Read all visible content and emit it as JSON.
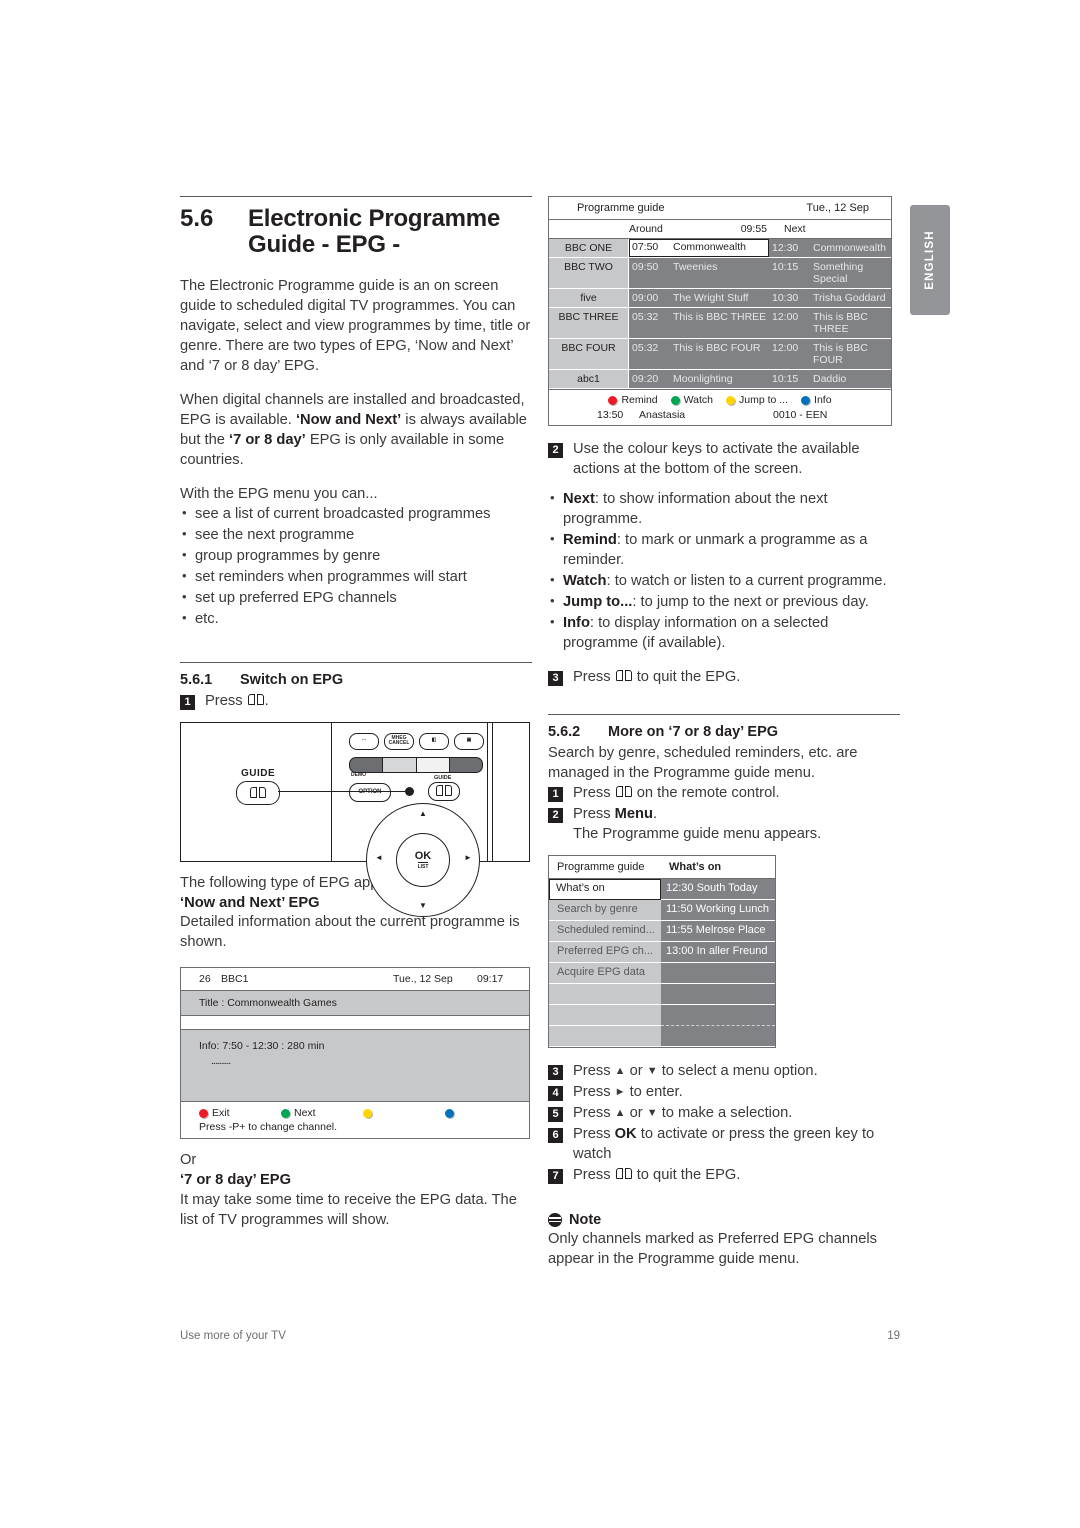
{
  "lang_tab": "ENGLISH",
  "footer": {
    "left": "Use more of your TV",
    "page": "19"
  },
  "section": {
    "number": "5.6",
    "title": "Electronic Programme Guide - EPG -",
    "intro_p1": "The Electronic Programme guide is an on screen guide to scheduled digital TV programmes. You can navigate, select and view programmes by time, title or genre. There are two types of EPG, ‘Now and Next’ and ‘7 or 8 day’ EPG.",
    "intro_p2_a": "When digital channels are installed and broadcasted, EPG is available. ",
    "intro_p2_b": "‘Now and Next’",
    "intro_p2_c": " is always available but the ",
    "intro_p2_d": "‘7 or 8 day’",
    "intro_p2_e": " EPG is only available in some countries.",
    "menu_intro": "With the EPG menu you can...",
    "menu_bullets": [
      "see a list of current broadcasted programmes",
      "see the next programme",
      "group programmes by genre",
      "set reminders when programmes will start",
      "set up preferred EPG channels",
      "etc."
    ]
  },
  "sub561": {
    "number": "5.6.1",
    "title": "Switch on EPG",
    "step1_n": "1",
    "step1_text_a": "Press ",
    "step1_text_b": ".",
    "after_remote": "The following type of EPG appears:",
    "now_next_heading": "‘Now and Next’ EPG",
    "now_next_body": "Detailed information about the current programme is shown.",
    "or": "Or",
    "seven_day_heading": "‘7 or 8 day’ EPG",
    "seven_day_body": "It may take some time to receive the EPG data. The list of TV programmes will show."
  },
  "sub562": {
    "number": "5.6.2",
    "title": "More on ‘7 or 8 day’ EPG",
    "intro": "Search by genre, scheduled reminders, etc. are managed in the Programme guide menu.",
    "step1_n": "1",
    "step1_a": "Press ",
    "step1_b": " on the remote control.",
    "step2_n": "2",
    "step2_a": "Press ",
    "step2_bold": "Menu",
    "step2_b": ".",
    "step2_cont": "The Programme guide menu appears.",
    "step3_n": "3",
    "step3_a": "Press ",
    "step3_b": " or ",
    "step3_c": " to select a menu option.",
    "step4_n": "4",
    "step4_a": "Press ",
    "step4_b": " to enter.",
    "step5_n": "5",
    "step5_a": "Press ",
    "step5_b": " or ",
    "step5_c": " to make a selection.",
    "step6_n": "6",
    "step6_a": "Press ",
    "step6_bold": "OK",
    "step6_b": " to activate or press the green key to",
    "step6_cont": "watch",
    "step7_n": "7",
    "step7_a": "Press ",
    "step7_b": " to quit the EPG."
  },
  "colour_keys": {
    "step_n": "2",
    "intro_a": "Use the colour keys to activate the available",
    "intro_b": "actions at the bottom of the screen.",
    "items": [
      {
        "label": "Next",
        "desc": ": to show information about the next programme."
      },
      {
        "label": "Remind",
        "desc": ": to mark or unmark a programme as a reminder."
      },
      {
        "label": "Watch",
        "desc": ": to watch or listen to a current programme."
      },
      {
        "label": "Jump to...",
        "desc": ": to jump to the next or previous day."
      },
      {
        "label": "Info",
        "desc": ": to display information on a selected programme (if available)."
      }
    ],
    "quit_n": "3",
    "quit_a": "Press ",
    "quit_b": " to quit the EPG."
  },
  "note": {
    "heading": "Note",
    "body": "Only channels marked as Preferred EPG channels appear in the Programme guide menu."
  },
  "epg_screen": {
    "title": "Programme guide",
    "date": "Tue., 12 Sep",
    "col_around": "Around",
    "col_time": "09:55",
    "col_next": "Next",
    "rows": [
      {
        "channel": "BBC ONE",
        "now_time": "07:50",
        "now_title": "Commonwealth",
        "next_time": "12:30",
        "next_title": "Commonwealth",
        "selected": true
      },
      {
        "channel": "BBC TWO",
        "now_time": "09:50",
        "now_title": "Tweenies",
        "next_time": "10:15",
        "next_title": "Something Special",
        "selected": false
      },
      {
        "channel": "five",
        "now_time": "09:00",
        "now_title": "The Wright Stuff",
        "next_time": "10:30",
        "next_title": "Trisha Goddard",
        "selected": false
      },
      {
        "channel": "BBC THREE",
        "now_time": "05:32",
        "now_title": "This is BBC THREE",
        "next_time": "12:00",
        "next_title": "This is BBC THREE",
        "selected": false
      },
      {
        "channel": "BBC FOUR",
        "now_time": "05:32",
        "now_title": "This is BBC FOUR",
        "next_time": "12:00",
        "next_title": "This is BBC FOUR",
        "selected": false
      },
      {
        "channel": "abc1",
        "now_time": "09:20",
        "now_title": "Moonlighting",
        "next_time": "10:15",
        "next_title": "Daddio",
        "selected": false
      }
    ],
    "keys": [
      {
        "colour": "#ed1c24",
        "label": "Remind"
      },
      {
        "colour": "#00a651",
        "label": "Watch"
      },
      {
        "colour": "#ffd400",
        "label": "Jump to ..."
      },
      {
        "colour": "#0072bc",
        "label": "Info"
      }
    ],
    "bottom_time": "13:50",
    "bottom_name": "Anastasia",
    "bottom_channel": "0010 - EEN"
  },
  "nownext_screen": {
    "channel_number": "26",
    "channel_name": "BBC1",
    "date": "Tue., 12 Sep",
    "time": "09:17",
    "title_line": "Title : Commonwealth Games",
    "info_line": "Info: 7:50 - 12:30 : 280 min",
    "info_dashes": "..........",
    "keys": [
      {
        "colour": "#ed1c24",
        "label": "Exit"
      },
      {
        "colour": "#00a651",
        "label": "Next"
      },
      {
        "colour": "#ffd400",
        "label": ""
      },
      {
        "colour": "#0072bc",
        "label": ""
      }
    ],
    "hint": "Press -P+ to change channel."
  },
  "pgmenu_screen": {
    "header_left": "Programme guide",
    "header_right": "What’s on",
    "left_items": [
      {
        "label": "What’s on",
        "selected": true
      },
      {
        "label": "Search by genre",
        "selected": false
      },
      {
        "label": "Scheduled remind...",
        "selected": false
      },
      {
        "label": "Preferred EPG ch...",
        "selected": false
      },
      {
        "label": "Acquire EPG data",
        "selected": false
      },
      {
        "label": "",
        "selected": false
      },
      {
        "label": "",
        "selected": false
      },
      {
        "label": "",
        "selected": false
      }
    ],
    "right_items": [
      "12:30 South Today",
      "11:50 Working Lunch",
      "11:55 Melrose Place",
      "13:00 In aller Freund",
      "",
      "",
      "",
      ""
    ]
  },
  "remote": {
    "guide_label": "GUIDE",
    "guide_label2": "GUIDE",
    "option_label": "OPTION",
    "demo_label": "DEMO",
    "cap_btn1": "⋯",
    "cap_btn2": "MHEG CANCEL",
    "cap_btn3": "□",
    "cap_btn4": "□",
    "ok_label": "OK",
    "list_label": "LIST"
  }
}
